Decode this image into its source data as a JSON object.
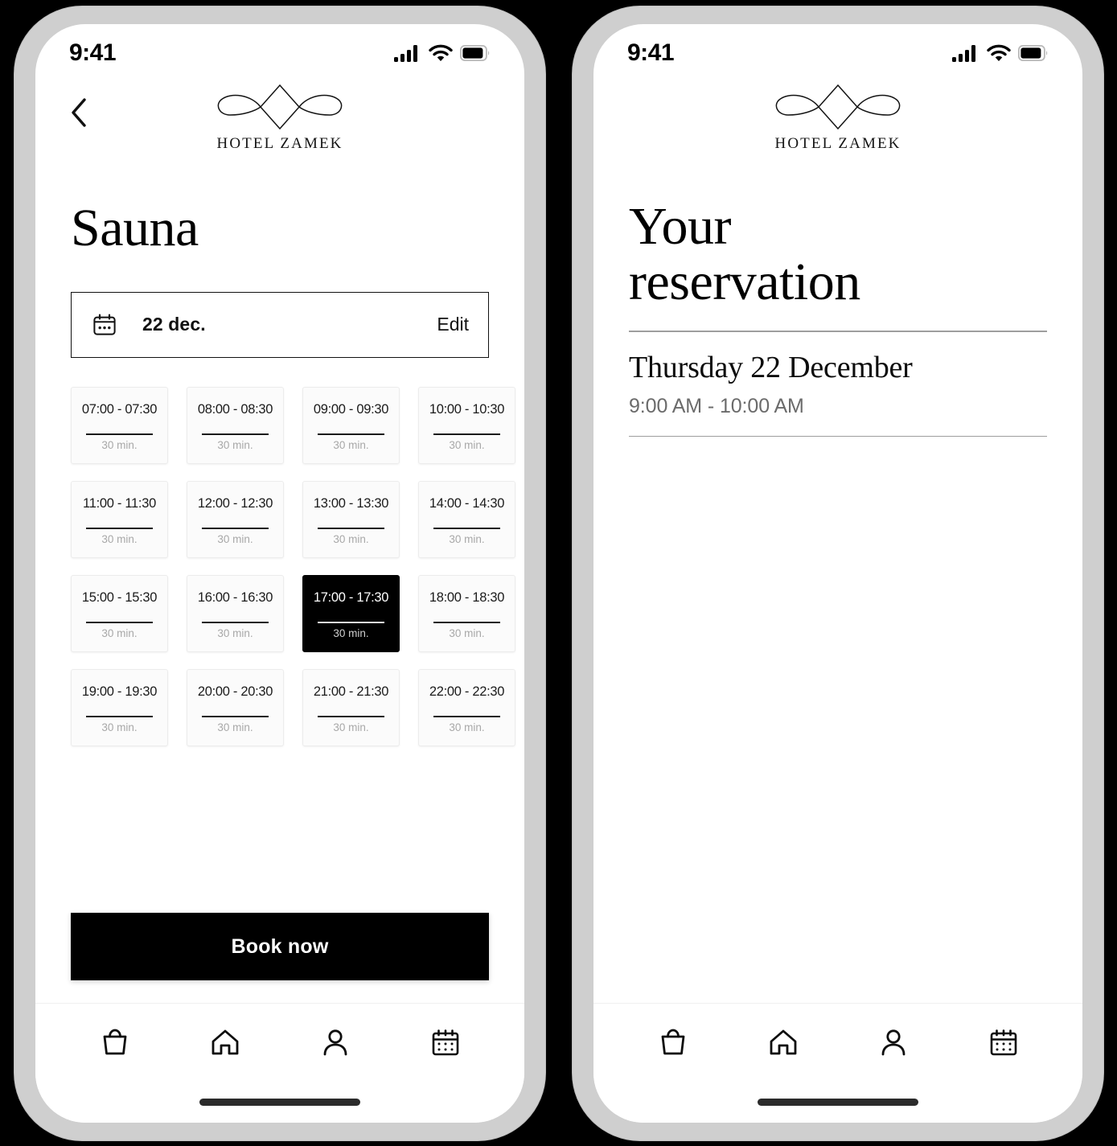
{
  "brand": {
    "name": "HOTEL ZAMEK",
    "logo_icon": "ornamental-diamond-flourish-logo"
  },
  "status_bar": {
    "time": "9:41",
    "icons": [
      "cellular-signal-icon",
      "wifi-icon",
      "battery-icon"
    ]
  },
  "screens": [
    {
      "id": "sauna-booking",
      "back_icon": "chevron-left-icon",
      "title": "Sauna",
      "date_selector": {
        "icon": "calendar-icon",
        "value": "22 dec.",
        "edit_label": "Edit"
      },
      "slots": [
        {
          "time": "07:00 - 07:30",
          "duration": "30 min.",
          "selected": false
        },
        {
          "time": "08:00 - 08:30",
          "duration": "30 min.",
          "selected": false
        },
        {
          "time": "09:00 - 09:30",
          "duration": "30 min.",
          "selected": false
        },
        {
          "time": "10:00 - 10:30",
          "duration": "30 min.",
          "selected": false
        },
        {
          "time": "11:00 - 11:30",
          "duration": "30 min.",
          "selected": false
        },
        {
          "time": "12:00 - 12:30",
          "duration": "30 min.",
          "selected": false
        },
        {
          "time": "13:00 - 13:30",
          "duration": "30 min.",
          "selected": false
        },
        {
          "time": "14:00 - 14:30",
          "duration": "30 min.",
          "selected": false
        },
        {
          "time": "15:00 - 15:30",
          "duration": "30 min.",
          "selected": false
        },
        {
          "time": "16:00 - 16:30",
          "duration": "30 min.",
          "selected": false
        },
        {
          "time": "17:00 - 17:30",
          "duration": "30 min.",
          "selected": true
        },
        {
          "time": "18:00 - 18:30",
          "duration": "30 min.",
          "selected": false
        },
        {
          "time": "19:00 - 19:30",
          "duration": "30 min.",
          "selected": false
        },
        {
          "time": "20:00 - 20:30",
          "duration": "30 min.",
          "selected": false
        },
        {
          "time": "21:00 - 21:30",
          "duration": "30 min.",
          "selected": false
        },
        {
          "time": "22:00 - 22:30",
          "duration": "30 min.",
          "selected": false
        }
      ],
      "primary_button": "Book now"
    },
    {
      "id": "your-reservation",
      "title_line_1": "Your",
      "title_line_2": "reservation",
      "reservation": {
        "day": "Thursday 22 December",
        "time": "9:00 AM - 10:00 AM"
      }
    }
  ],
  "tab_bar": {
    "items": [
      {
        "icon": "shopping-bag-icon",
        "name": "tab-bag"
      },
      {
        "icon": "home-icon",
        "name": "tab-home"
      },
      {
        "icon": "person-icon",
        "name": "tab-profile"
      },
      {
        "icon": "calendar-icon",
        "name": "tab-calendar"
      }
    ]
  },
  "colors": {
    "accent": "#000000",
    "surface": "#ffffff",
    "muted_text": "#a8a8a8",
    "frame": "#cfcfcf",
    "canvas": "#000000"
  }
}
